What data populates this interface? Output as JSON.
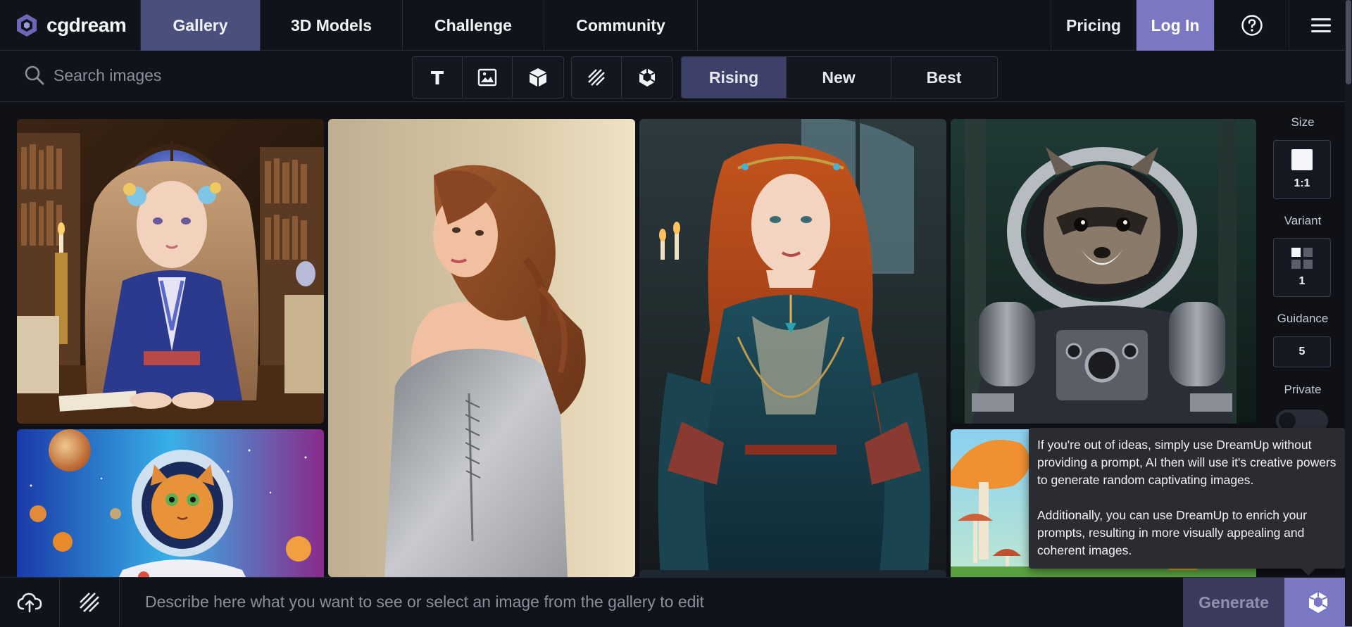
{
  "brand": {
    "name": "cgdream"
  },
  "nav": {
    "tabs": [
      {
        "label": "Gallery",
        "active": true
      },
      {
        "label": "3D Models"
      },
      {
        "label": "Challenge"
      },
      {
        "label": "Community"
      }
    ],
    "pricing_label": "Pricing",
    "login_label": "Log In",
    "help_icon": "help-circle-icon",
    "menu_icon": "hamburger-menu-icon"
  },
  "toolbar": {
    "search_placeholder": "Search images",
    "filter_icons": [
      "text-icon",
      "image-icon",
      "cube-icon",
      "stripes-icon",
      "dreamup-icon"
    ],
    "sort": [
      {
        "label": "Rising",
        "active": true
      },
      {
        "label": "New"
      },
      {
        "label": "Best"
      }
    ]
  },
  "panel": {
    "size_label": "Size",
    "size_value": "1:1",
    "variant_label": "Variant",
    "variant_value": "1",
    "guidance_label": "Guidance",
    "guidance_value": "5",
    "private_label": "Private"
  },
  "tooltip": {
    "para1": "If you're out of ideas, simply use DreamUp without providing a prompt, AI then will use it's creative powers to generate random captivating images.",
    "para2": "Additionally, you can use DreamUp to enrich your prompts, resulting in more visually appealing and coherent images."
  },
  "bottombar": {
    "prompt_placeholder": "Describe here what you want to see or select an image from the gallery to edit",
    "generate_label": "Generate",
    "upload_icon": "cloud-upload-icon",
    "stripes_icon": "stripes-icon",
    "dreamup_icon": "dreamup-icon"
  },
  "colors": {
    "accent": "#7a78c2",
    "active_tab": "#4b4f7c",
    "background": "#0f1117"
  }
}
